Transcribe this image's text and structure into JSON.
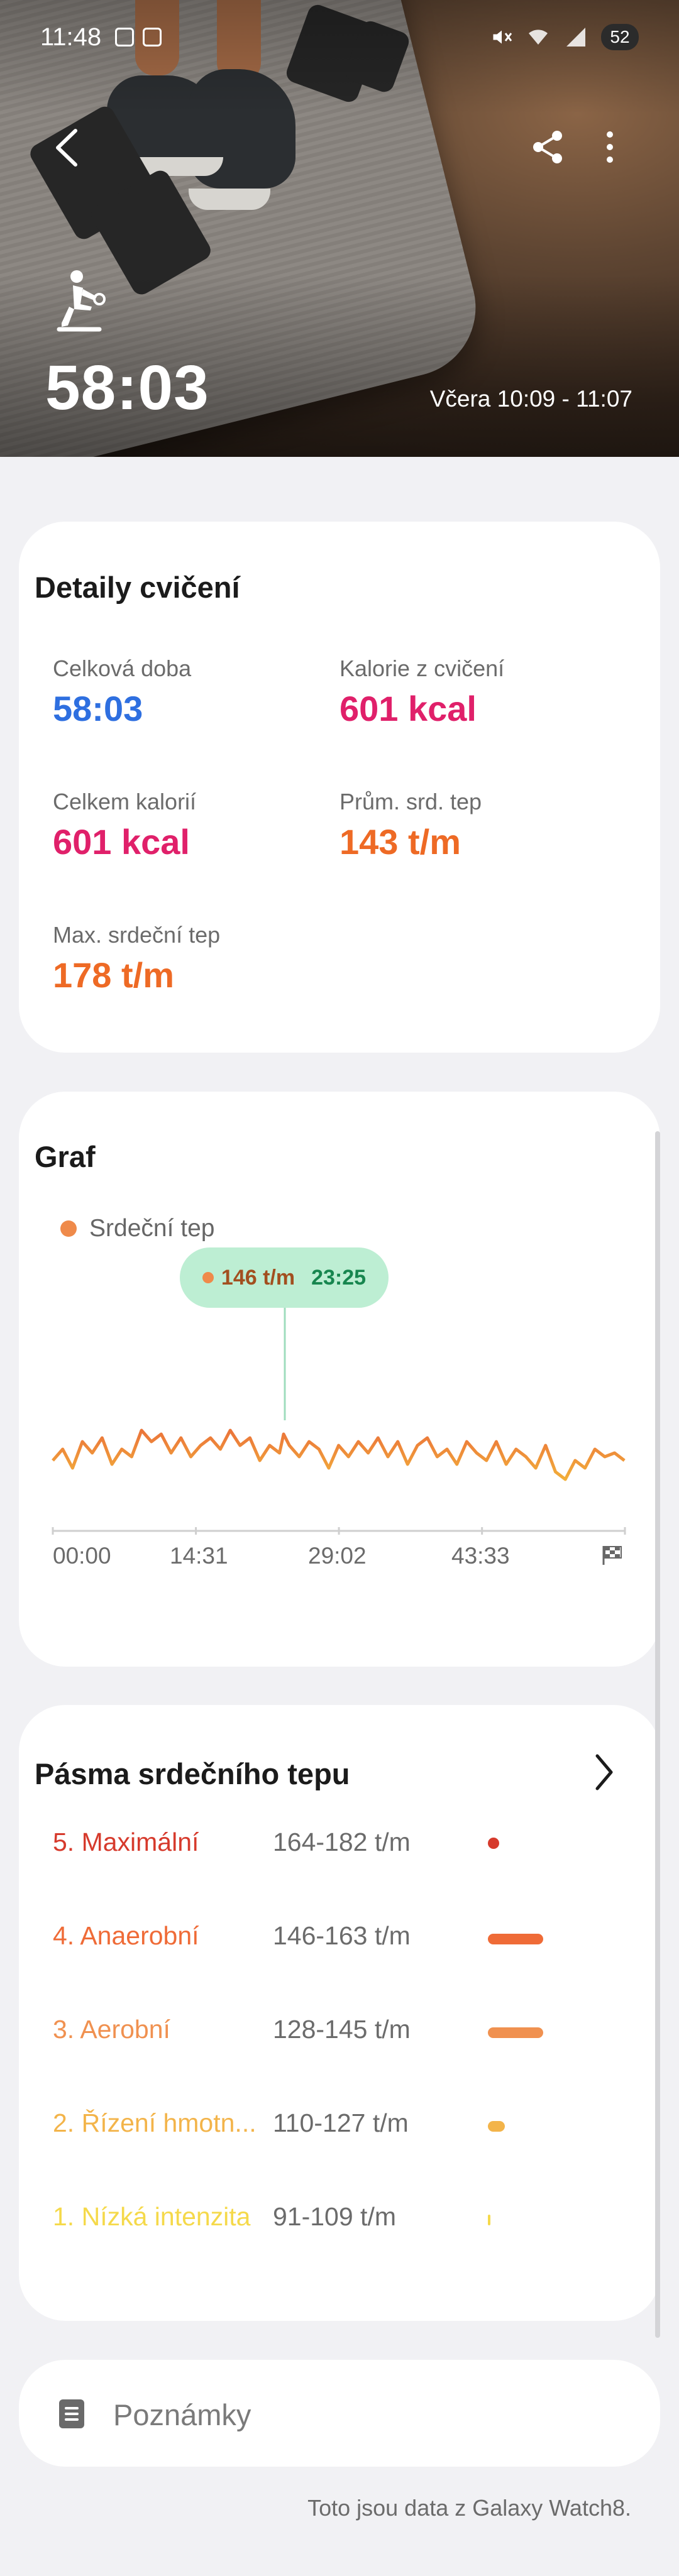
{
  "status_bar": {
    "time": "11:48",
    "battery": "52"
  },
  "header": {
    "duration": "58:03",
    "date_range": "Včera 10:09 - 11:07"
  },
  "details": {
    "title": "Detaily cvičení",
    "stats": [
      {
        "label": "Celková doba",
        "value": "58:03",
        "color": "#2e6fe0"
      },
      {
        "label": "Kalorie z cvičení",
        "value": "601 kcal",
        "color": "#e0206a"
      },
      {
        "label": "Celkem kalorií",
        "value": "601 kcal",
        "color": "#e0206a"
      },
      {
        "label": "Prům. srd. tep",
        "value": "143 t/m",
        "color": "#ee6a25"
      },
      {
        "label": "Max. srdeční tep",
        "value": "178 t/m",
        "color": "#ee6a25"
      }
    ]
  },
  "graph": {
    "title": "Graf",
    "legend": "Srdeční tep",
    "legend_color": "#ef8a4a",
    "tooltip": {
      "value": "146 t/m",
      "time": "23:25"
    },
    "x_labels": [
      "00:00",
      "14:31",
      "29:02",
      "43:33"
    ],
    "finish_icon": "checkered-flag-icon"
  },
  "chart_data": {
    "type": "line",
    "title": "Graf",
    "xlabel": "",
    "ylabel": "",
    "x_tick_labels": [
      "00:00",
      "14:31",
      "29:02",
      "43:33"
    ],
    "xlim": [
      0,
      58.05
    ],
    "ylim": [
      100,
      190
    ],
    "series": [
      {
        "name": "Srdeční tep",
        "x": [
          0,
          1,
          2,
          3,
          4,
          5,
          6,
          7,
          8,
          9,
          10,
          11,
          12,
          13,
          14,
          15,
          16,
          17,
          18,
          19,
          20,
          21,
          22,
          23,
          23.42,
          24,
          25,
          26,
          27,
          28,
          29,
          30,
          31,
          32,
          33,
          34,
          35,
          36,
          37,
          38,
          39,
          40,
          41,
          42,
          43,
          44,
          45,
          46,
          47,
          48,
          49,
          50,
          51,
          52,
          53,
          54,
          55,
          56,
          57,
          58
        ],
        "values": [
          132,
          138,
          128,
          142,
          136,
          144,
          130,
          138,
          134,
          148,
          142,
          146,
          136,
          144,
          134,
          140,
          144,
          138,
          148,
          140,
          144,
          132,
          140,
          136,
          146,
          140,
          134,
          142,
          138,
          128,
          140,
          134,
          142,
          136,
          144,
          134,
          142,
          130,
          140,
          144,
          134,
          138,
          130,
          142,
          136,
          132,
          142,
          130,
          138,
          134,
          128,
          140,
          126,
          122,
          132,
          128,
          138,
          134,
          136,
          132
        ]
      }
    ],
    "grid": false,
    "legend_position": "top-left"
  },
  "zones": {
    "title": "Pásma srdečního tepu",
    "items": [
      {
        "name": "5. Maximální",
        "range": "164-182 t/m",
        "color": "#d63a2c",
        "fraction": 0.02
      },
      {
        "name": "4. Anaerobní",
        "range": "146-163 t/m",
        "color": "#ef6b37",
        "fraction": 0.36
      },
      {
        "name": "3. Aerobní",
        "range": "128-145 t/m",
        "color": "#f09150",
        "fraction": 0.36
      },
      {
        "name": "2. Řízení hmotn...",
        "range": "110-127 t/m",
        "color": "#f3b44a",
        "fraction": 0.11
      },
      {
        "name": "1. Nízká intenzita",
        "range": "91-109 t/m",
        "color": "#f5d94a",
        "fraction": 0.01
      }
    ]
  },
  "notes": {
    "label": "Poznámky"
  },
  "footer": {
    "source": "Toto jsou data z Galaxy Watch8."
  }
}
